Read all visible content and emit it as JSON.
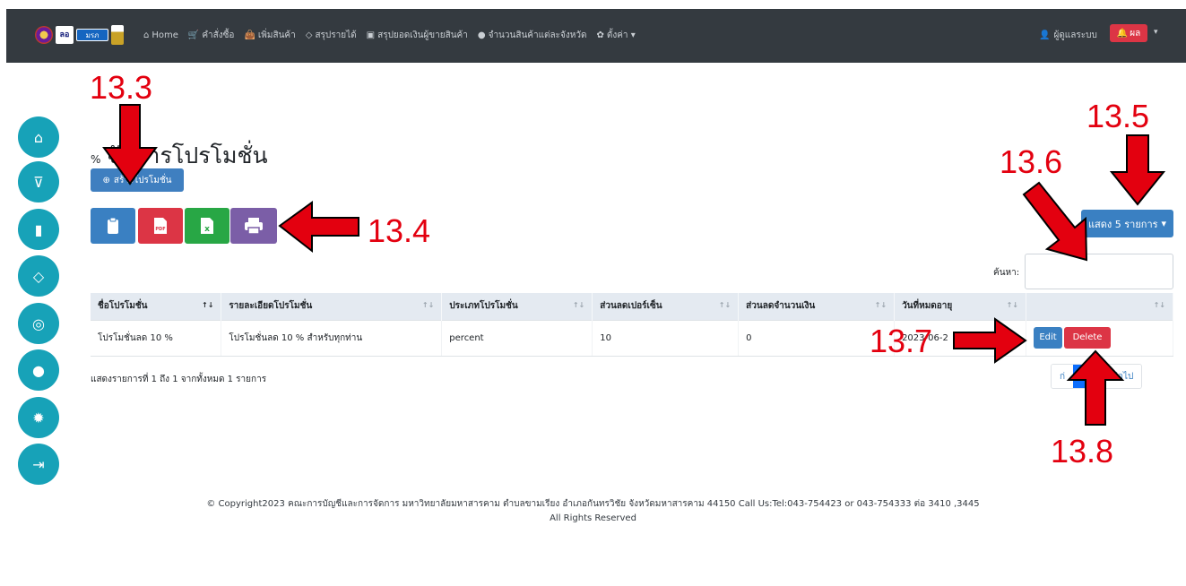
{
  "navbar": {
    "logos": [
      "ลอ",
      "มรภ"
    ],
    "items": [
      {
        "icon": "home-icon",
        "glyph": "⌂",
        "label": "Home"
      },
      {
        "icon": "cart-icon",
        "glyph": "🛒",
        "label": "คำสั่งซื้อ"
      },
      {
        "icon": "bag-icon",
        "glyph": "👜",
        "label": "เพิ่มสินค้า"
      },
      {
        "icon": "diamond-icon",
        "glyph": "◇",
        "label": "สรุปรายได้"
      },
      {
        "icon": "money-icon",
        "glyph": "▣",
        "label": "สรุปยอดเงินผู้ขายสินค้า"
      },
      {
        "icon": "map-pin-icon",
        "glyph": "●",
        "label": "จำนวนสินค้าแต่ละจังหวัด"
      },
      {
        "icon": "gear-icon",
        "glyph": "✿",
        "label": "ตั้งค่า ▾"
      }
    ],
    "user_label": "ผู้ดูแลระบบ",
    "badge_label": "ผล",
    "caret": "▾"
  },
  "sidebar": [
    {
      "icon": "home-icon",
      "glyph": "⌂"
    },
    {
      "icon": "cart-icon",
      "glyph": "⊽"
    },
    {
      "icon": "bag-icon",
      "glyph": "▮"
    },
    {
      "icon": "diamond-icon",
      "glyph": "◇"
    },
    {
      "icon": "money-icon",
      "glyph": "◎"
    },
    {
      "icon": "map-pin-icon",
      "glyph": "●"
    },
    {
      "icon": "gear-icon",
      "glyph": "✹"
    },
    {
      "icon": "logout-icon",
      "glyph": "⇥"
    }
  ],
  "main": {
    "title_prefix": "%",
    "title": "จัดการโปรโมชั่น",
    "create_label": "สร้างโปรโมชั่น",
    "show_label": "แสดง 5 รายการ",
    "search_label": "ค้นหา:",
    "search_value": "",
    "table": {
      "headers": [
        "ชื่อโปรโมชั่น",
        "รายละเอียดโปรโมชั่น",
        "ประเภทโปรโมชั่น",
        "ส่วนลดเปอร์เซ็น",
        "ส่วนลดจำนวนเงิน",
        "วันที่หมดอายุ",
        ""
      ],
      "rows": [
        [
          "โปรโมชั่นลด 10 %",
          "โปรโมชั่นลด 10 % สำหรับทุกท่าน",
          "percent",
          "10",
          "0",
          "2023-06-2"
        ]
      ],
      "edit_label": "Edit",
      "delete_label": "Delete"
    },
    "info": "แสดงรายการที่ 1 ถึง 1 จากทั้งหมด 1 รายการ",
    "pager": {
      "prev": "ก่",
      "current": "1",
      "next": "ต่อไป"
    }
  },
  "footer": {
    "line1": "© Copyright2023 คณะการบัญชีและการจัดการ มหาวิทยาลัยมหาสารคาม ตำบลขามเรียง อำเภอกันทรวิชัย จังหวัดมหาสารคาม 44150 Call Us:Tel:043-754423 or 043-754333 ต่อ 3410 ,3445",
    "line2": "All Rights Reserved"
  },
  "annotations": [
    "13.3",
    "13.4",
    "13.5",
    "13.6",
    "13.7",
    "13.8"
  ],
  "colors": {
    "navbar": "#343a40",
    "sidebar": "#17a2b8",
    "primary": "#3a80c2",
    "danger": "#dc3545",
    "success": "#28a745",
    "annotation": "#e3000f"
  }
}
